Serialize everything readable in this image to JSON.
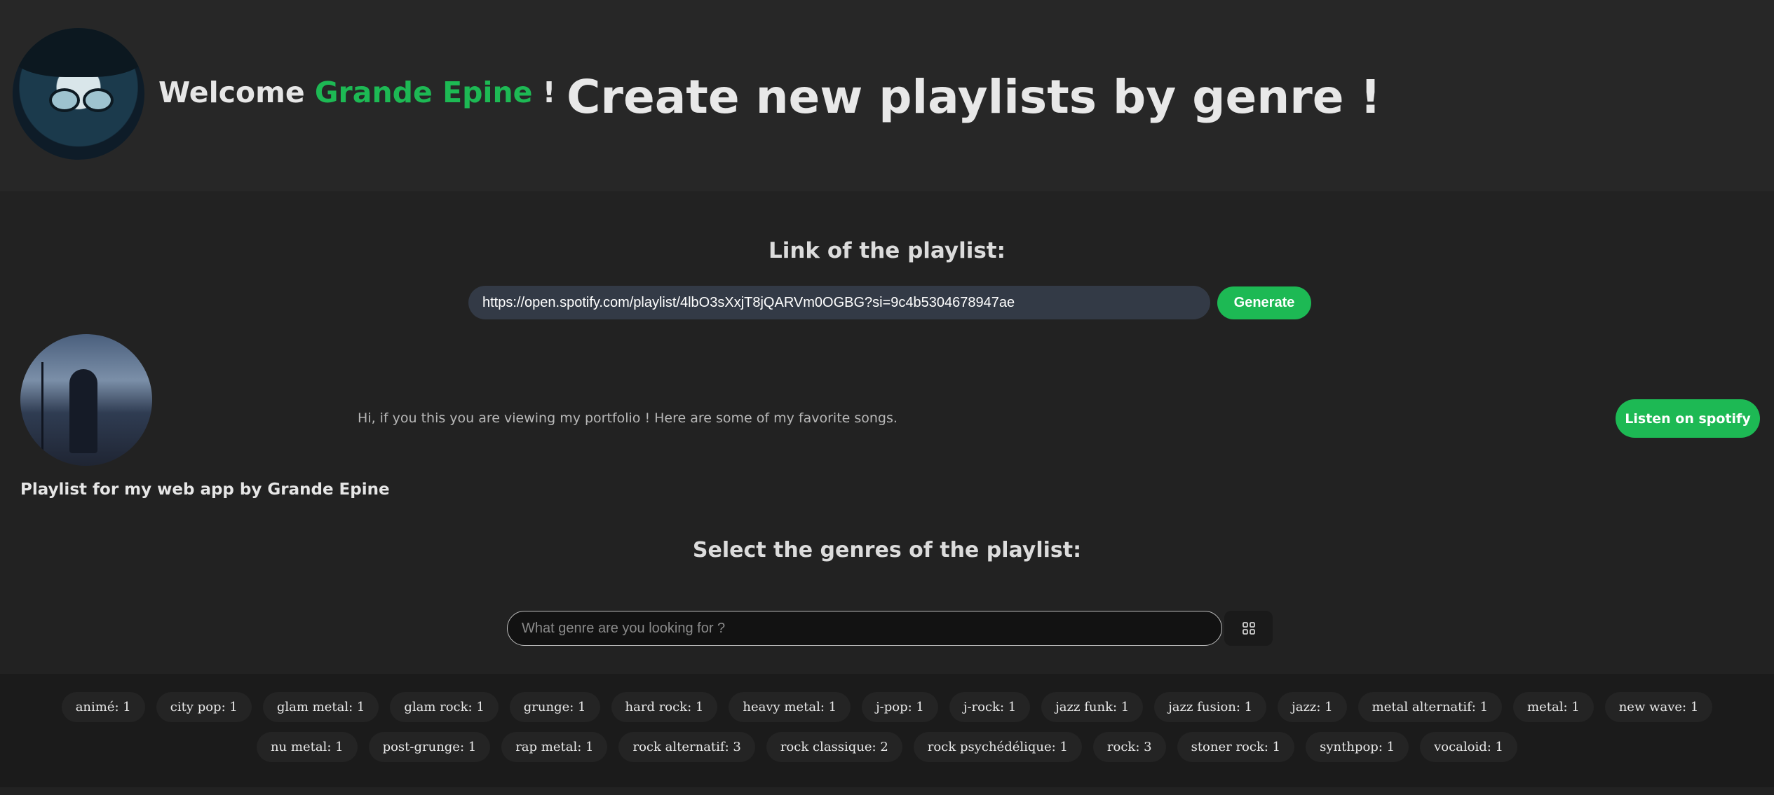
{
  "header": {
    "welcome_prefix": "Welcome",
    "user_name": "Grande Epine",
    "welcome_suffix": "!",
    "headline": "Create new playlists by genre !"
  },
  "link_section": {
    "label": "Link of the playlist:",
    "url_value": "https://open.spotify.com/playlist/4lbO3sXxjT8jQARVm0OGBG?si=9c4b5304678947ae",
    "generate_label": "Generate"
  },
  "playlist": {
    "title": "Playlist for my web app by Grande Epine",
    "description": "Hi, if you this you are viewing my portfolio ! Here are some of my favorite songs.",
    "listen_label": "Listen on spotify"
  },
  "genres_section": {
    "label": "Select the genres of the playlist:",
    "search_placeholder": "What genre are you looking for ?",
    "grid_icon": "grid-icon"
  },
  "genres": [
    "animé: 1",
    "city pop: 1",
    "glam metal: 1",
    "glam rock: 1",
    "grunge: 1",
    "hard rock: 1",
    "heavy metal: 1",
    "j-pop: 1",
    "j-rock: 1",
    "jazz funk: 1",
    "jazz fusion: 1",
    "jazz: 1",
    "metal alternatif: 1",
    "metal: 1",
    "new wave: 1",
    "nu metal: 1",
    "post-grunge: 1",
    "rap metal: 1",
    "rock alternatif: 3",
    "rock classique: 2",
    "rock psychédélique: 1",
    "rock: 3",
    "stoner rock: 1",
    "synthpop: 1",
    "vocaloid: 1"
  ],
  "colors": {
    "accent": "#1db954",
    "background": "#222222",
    "header_background": "#272727"
  }
}
